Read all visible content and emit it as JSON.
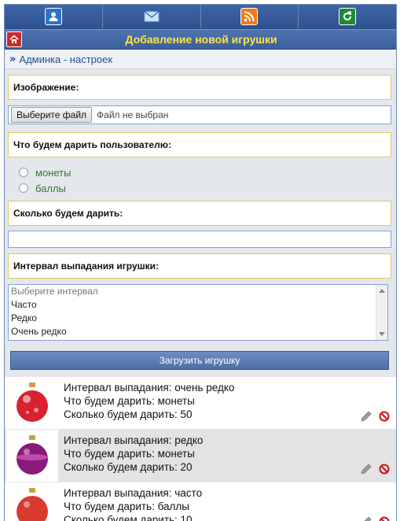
{
  "nav": {
    "items": [
      {
        "icon": "user-icon",
        "color": "#2a74c9"
      },
      {
        "icon": "mail-icon",
        "color": "#5aa0e0"
      },
      {
        "icon": "rss-icon",
        "color": "#f07c1a"
      },
      {
        "icon": "refresh-icon",
        "color": "#1f8a35"
      }
    ]
  },
  "header": {
    "title": "Добавление новой игрушки",
    "title_color": "#ffe34a"
  },
  "breadcrumb": {
    "arrow": "»",
    "link": "Админка - настроек"
  },
  "form": {
    "image_label": "Изображение:",
    "file_button": "Выберите файл",
    "file_status": "Файл не выбран",
    "gift_label": "Что будем дарить пользователю:",
    "gift_options": [
      "монеты",
      "баллы"
    ],
    "amount_label": "Сколько будем дарить:",
    "amount_value": "",
    "interval_label": "Интервал выпадания игрушки:",
    "interval_options": [
      "Выберите интервал",
      "Часто",
      "Редко",
      "Очень редко"
    ],
    "submit_label": "Загрузить игрушку"
  },
  "toys": [
    {
      "interval": "Интервал выпадания: очень редко",
      "gift": "Что будем дарить: монеты",
      "amount": "Сколько будем дарить: 50",
      "ball_color": "#d8222d"
    },
    {
      "interval": "Интервал выпадания: редко",
      "gift": "Что будем дарить: монеты",
      "amount": "Сколько будем дарить: 20",
      "ball_color": "#8a1a7a"
    },
    {
      "interval": "Интервал выпадания: часто",
      "gift": "Что будем дарить: баллы",
      "amount": "Сколько будем дарить: 10",
      "ball_color": "#d83a30"
    }
  ]
}
